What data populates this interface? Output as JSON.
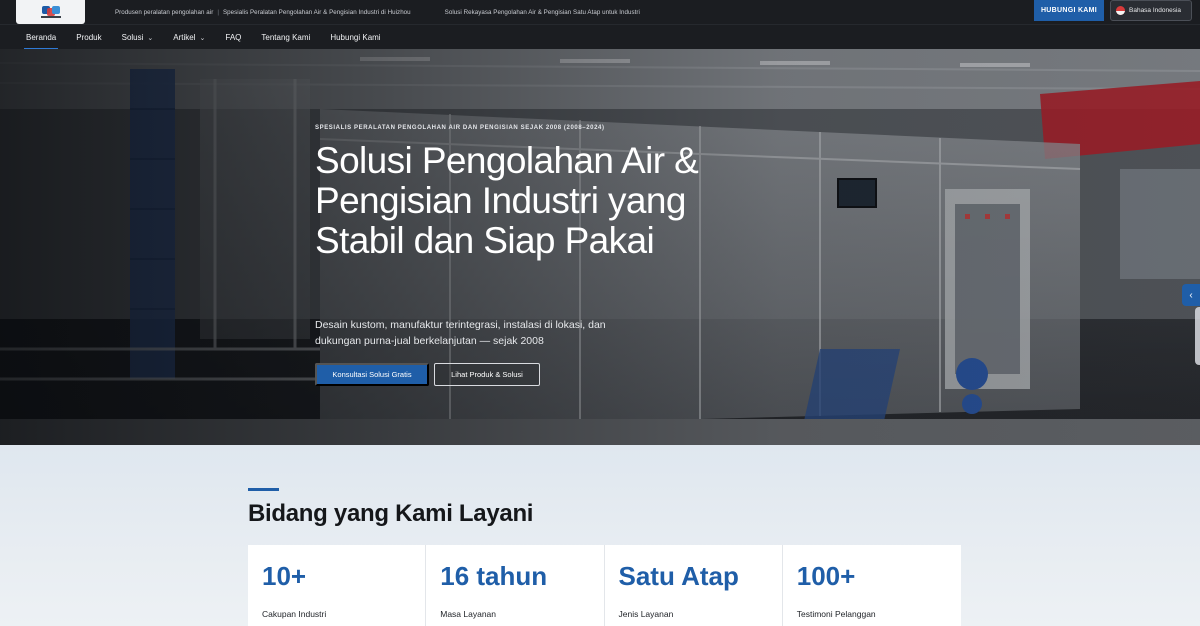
{
  "header": {
    "taglines": [
      "Produsen peralatan pengolahan air",
      "Spesialis Peralatan Pengolahan Air & Pengisian Industri di Huizhou",
      "Solusi Rekayasa Pengolahan Air & Pengisian Satu Atap untuk Industri"
    ],
    "contact_button": "HUBUNGI KAMI",
    "language": "Bahasa Indonesia"
  },
  "nav": {
    "items": [
      {
        "label": "Beranda"
      },
      {
        "label": "Produk"
      },
      {
        "label": "Solusi"
      },
      {
        "label": "Artikel"
      },
      {
        "label": "FAQ"
      },
      {
        "label": "Tentang Kami"
      },
      {
        "label": "Hubungi Kami"
      }
    ]
  },
  "hero": {
    "eyebrow": "SPESIALIS PERALATAN PENGOLAHAN AIR DAN PENGISIAN SEJAK 2008 (2008–2024)",
    "title": "Solusi Pengolahan Air & Pengisian Industri yang Stabil dan Siap Pakai",
    "subtitle": "Desain kustom, manufaktur terintegrasi, instalasi di lokasi, dan dukungan purna-jual berkelanjutan — sejak 2008",
    "primary_button": "Konsultasi Solusi Gratis",
    "secondary_button": "Lihat Produk & Solusi"
  },
  "services": {
    "title": "Bidang yang Kami Layani",
    "stats": [
      {
        "value": "10+",
        "label": "Cakupan Industri"
      },
      {
        "value": "16 tahun",
        "label": "Masa Layanan"
      },
      {
        "value": "Satu Atap",
        "label": "Jenis Layanan"
      },
      {
        "value": "100+",
        "label": "Testimoni Pelanggan"
      }
    ]
  },
  "colors": {
    "brand_blue": "#1f5ea8",
    "topbar_bg": "#1b1d21"
  }
}
